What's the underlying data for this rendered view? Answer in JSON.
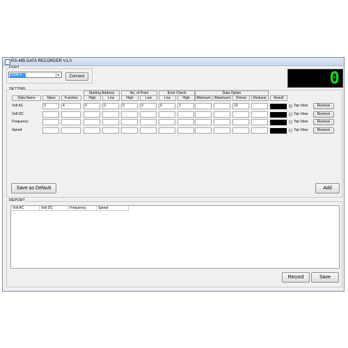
{
  "window": {
    "title": "RS-485 DATA RECORDER V1.0"
  },
  "port": {
    "label": "PORT",
    "selected": "COM 4",
    "connect_label": "Connect"
  },
  "display": {
    "value": "0",
    "color": "#1bd81b"
  },
  "setting": {
    "label": "SETTING",
    "group_headers": [
      "Starting Address",
      "No. of Point",
      "Error Check",
      "Data Option"
    ],
    "columns": [
      "Data Name",
      "Slave",
      "Function",
      "High",
      "Low",
      "High",
      "Low",
      "Low",
      "High",
      "Minimum",
      "Maximum",
      "Divisor",
      "Reducer",
      "Result"
    ],
    "rows": [
      {
        "name": "Volt AC",
        "values": [
          "3",
          "4",
          "0",
          "0",
          "0",
          "0",
          "0",
          "1",
          "",
          "",
          "10",
          ""
        ],
        "top_view": "Top View",
        "remove": "Remove",
        "selected": true
      },
      {
        "name": "Volt DC",
        "values": [
          "",
          "",
          "",
          "",
          "",
          "",
          "",
          "",
          "",
          "",
          "",
          ""
        ],
        "top_view": "Top View",
        "remove": "Remove",
        "selected": false
      },
      {
        "name": "Frequency",
        "values": [
          "",
          "",
          "",
          "",
          "",
          "",
          "",
          "",
          "",
          "",
          "",
          ""
        ],
        "top_view": "Top View",
        "remove": "Remove",
        "selected": false
      },
      {
        "name": "Speed",
        "values": [
          "",
          "",
          "",
          "",
          "",
          "",
          "",
          "",
          "",
          "",
          "",
          ""
        ],
        "top_view": "Top View",
        "remove": "Remove",
        "selected": false
      }
    ],
    "save_default_label": "Save as Default",
    "add_label": "Add"
  },
  "report": {
    "label": "REPORT",
    "columns": [
      "Volt AC",
      "Volt DC",
      "Frequency",
      "Speed"
    ],
    "record_label": "Record",
    "save_label": "Save"
  }
}
